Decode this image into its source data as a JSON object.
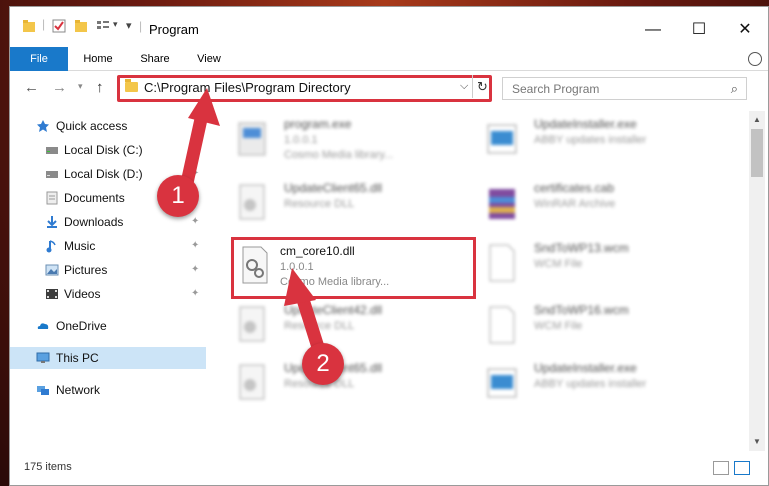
{
  "window": {
    "title": "Program"
  },
  "controls": {
    "minimize": "—",
    "maximize": "☐",
    "close": "✕"
  },
  "ribbon": {
    "tabs": [
      "File",
      "Home",
      "Share",
      "View"
    ]
  },
  "address": {
    "path": "C:\\Program Files\\Program Directory"
  },
  "search": {
    "placeholder": "Search Program"
  },
  "sidebar": {
    "items": [
      {
        "label": "Quick access",
        "icon": "star-icon",
        "pinned": false
      },
      {
        "label": "Local Disk (C:)",
        "icon": "drive-icon",
        "pinned": false
      },
      {
        "label": "Local Disk (D:)",
        "icon": "drive-icon",
        "pinned": true
      },
      {
        "label": "Documents",
        "icon": "documents-icon",
        "pinned": true
      },
      {
        "label": "Downloads",
        "icon": "downloads-icon",
        "pinned": true
      },
      {
        "label": "Music",
        "icon": "music-icon",
        "pinned": true
      },
      {
        "label": "Pictures",
        "icon": "pictures-icon",
        "pinned": true
      },
      {
        "label": "Videos",
        "icon": "videos-icon",
        "pinned": true
      },
      {
        "label": "OneDrive",
        "icon": "onedrive-icon",
        "pinned": false
      },
      {
        "label": "This PC",
        "icon": "this-pc-icon",
        "pinned": false,
        "selected": true
      },
      {
        "label": "Network",
        "icon": "network-icon",
        "pinned": false
      }
    ]
  },
  "files": [
    {
      "name": "program.exe",
      "line1": "1.0.0.1",
      "line2": "Cosmo Media library...",
      "icon": "exe-icon"
    },
    {
      "name": "UpdateInstaller.exe",
      "line1": "ABBY updates installer",
      "line2": "",
      "icon": "installer-icon"
    },
    {
      "name": "UpdateClient65.dll",
      "line1": "Resource DLL",
      "line2": "",
      "icon": "dll-icon"
    },
    {
      "name": "certificates.cab",
      "line1": "WinRAR Archive",
      "line2": "",
      "icon": "archive-icon"
    },
    {
      "name": "cm_core10.dll",
      "line1": "1.0.0.1",
      "line2": "Cosmo Media library...",
      "icon": "dll-gear-icon"
    },
    {
      "name": "SndToWP13.wcm",
      "line1": "WCM File",
      "line2": "",
      "icon": "file-icon"
    },
    {
      "name": "UpdateClient42.dll",
      "line1": "Resource DLL",
      "line2": "",
      "icon": "dll-icon"
    },
    {
      "name": "SndToWP16.wcm",
      "line1": "WCM File",
      "line2": "",
      "icon": "file-icon"
    },
    {
      "name": "UpdateClient65.dll",
      "line1": "Resource DLL",
      "line2": "",
      "icon": "dll-icon"
    },
    {
      "name": "UpdateInstaller.exe",
      "line1": "ABBY updates installer",
      "line2": "",
      "icon": "installer-icon"
    }
  ],
  "status": {
    "items": "175 items"
  },
  "annotations": {
    "step1": "1",
    "step2": "2"
  },
  "colors": {
    "accent": "#1979ca",
    "highlight": "#d9333f",
    "selected": "#cce4f7"
  }
}
